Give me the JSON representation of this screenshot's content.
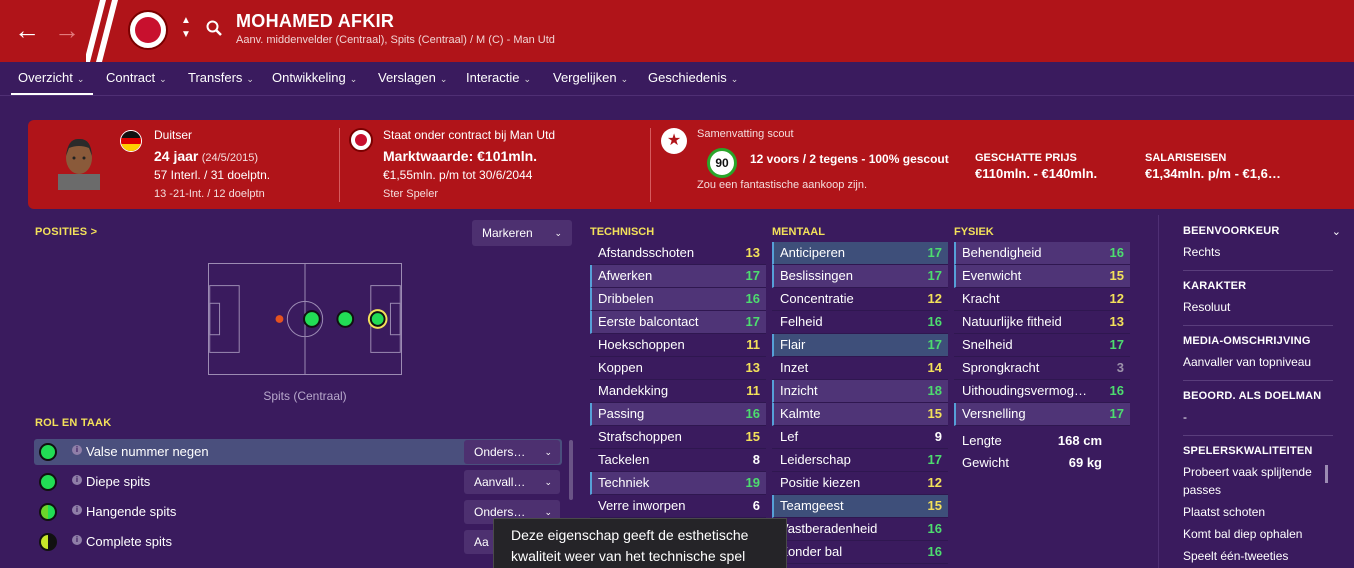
{
  "header": {
    "player_name": "MOHAMED AFKIR",
    "player_subtitle": "Aanv. middenvelder (Centraal), Spits (Centraal) / M (C) - Man Utd",
    "back_icon": "arrow-left-icon",
    "forward_icon": "arrow-right-icon",
    "colors": {
      "header_bg": "#b01419",
      "page_bg": "#3a1b5e"
    }
  },
  "tabs": [
    {
      "label": "Overzicht"
    },
    {
      "label": "Contract"
    },
    {
      "label": "Transfers"
    },
    {
      "label": "Ontwikkeling"
    },
    {
      "label": "Verslagen"
    },
    {
      "label": "Interactie"
    },
    {
      "label": "Vergelijken"
    },
    {
      "label": "Geschiedenis"
    }
  ],
  "summary": {
    "nationality": "Duitser",
    "age": "24 jaar",
    "dob": "(24/5/2015)",
    "caps": "57 Interl. / 31 doelptn.",
    "youth_caps": "13 -21-Int. / 12 doelptn",
    "contract_status": "Staat onder contract bij Man Utd",
    "market_value": "Marktwaarde: €101mln.",
    "wage": "€1,55mln. p/m tot 30/6/2044",
    "status": "Ster Speler",
    "scout_title": "Samenvatting scout",
    "scout_rating": "90",
    "scout_summary": "12 voors / 2 tegens - 100% gescout",
    "scout_note": "Zou een fantastische aankoop zijn.",
    "price_label": "GESCHATTE PRIJS",
    "price_value": "€110mln. - €140mln.",
    "salary_label": "SALARISEISEN",
    "salary_value": "€1,34mln. p/m - €1,6…"
  },
  "positions": {
    "title": "POSITIES",
    "title_suffix": ">",
    "marker_button": "Markeren",
    "pitch_label": "Spits (Centraal)"
  },
  "roles": {
    "title": "ROL EN TAAK",
    "items": [
      {
        "name": "Valse nummer negen",
        "duty": "Onders…",
        "color": "#22dd55"
      },
      {
        "name": "Diepe spits",
        "duty": "Aanvall…",
        "color": "#22dd55"
      },
      {
        "name": "Hangende spits",
        "duty": "Onders…",
        "color": "#6bd62a"
      },
      {
        "name": "Complete spits",
        "duty": "Aa",
        "color": "#c7e62a"
      }
    ]
  },
  "technical": {
    "title": "TECHNISCH",
    "attrs": [
      {
        "name": "Afstandsschoten",
        "value": "13"
      },
      {
        "name": "Afwerken",
        "value": "17"
      },
      {
        "name": "Dribbelen",
        "value": "16"
      },
      {
        "name": "Eerste balcontact",
        "value": "17"
      },
      {
        "name": "Hoekschoppen",
        "value": "11"
      },
      {
        "name": "Koppen",
        "value": "13"
      },
      {
        "name": "Mandekking",
        "value": "11"
      },
      {
        "name": "Passing",
        "value": "16"
      },
      {
        "name": "Strafschoppen",
        "value": "15"
      },
      {
        "name": "Tackelen",
        "value": "8"
      },
      {
        "name": "Techniek",
        "value": "19"
      },
      {
        "name": "Verre inworpen",
        "value": "6"
      }
    ]
  },
  "mental": {
    "title": "MENTAAL",
    "attrs": [
      {
        "name": "Anticiperen",
        "value": "17"
      },
      {
        "name": "Beslissingen",
        "value": "17"
      },
      {
        "name": "Concentratie",
        "value": "12"
      },
      {
        "name": "Felheid",
        "value": "16"
      },
      {
        "name": "Flair",
        "value": "17"
      },
      {
        "name": "Inzet",
        "value": "14"
      },
      {
        "name": "Inzicht",
        "value": "18"
      },
      {
        "name": "Kalmte",
        "value": "15"
      },
      {
        "name": "Lef",
        "value": "9"
      },
      {
        "name": "Leiderschap",
        "value": "17"
      },
      {
        "name": "Positie kiezen",
        "value": "12"
      },
      {
        "name": "Teamgeest",
        "value": "15"
      },
      {
        "name": "Vastberadenheid",
        "value": "16"
      },
      {
        "name": "Zonder bal",
        "value": "16"
      }
    ]
  },
  "physical": {
    "title": "FYSIEK",
    "attrs": [
      {
        "name": "Behendigheid",
        "value": "16"
      },
      {
        "name": "Evenwicht",
        "value": "15"
      },
      {
        "name": "Kracht",
        "value": "12"
      },
      {
        "name": "Natuurlijke fitheid",
        "value": "13"
      },
      {
        "name": "Snelheid",
        "value": "17"
      },
      {
        "name": "Sprongkracht",
        "value": "3"
      },
      {
        "name": "Uithoudingsvermog…",
        "value": "16"
      },
      {
        "name": "Versnelling",
        "value": "17"
      }
    ],
    "height_label": "Lengte",
    "height_value": "168 cm",
    "weight_label": "Gewicht",
    "weight_value": "69 kg"
  },
  "info": {
    "foot_label": "BEENVOORKEUR",
    "foot_value": "Rechts",
    "personality_label": "KARAKTER",
    "personality_value": "Resoluut",
    "media_label": "MEDIA-OMSCHRIJVING",
    "media_value": "Aanvaller van topniveau",
    "gk_label": "BEOORD. ALS DOELMAN",
    "gk_value": "-",
    "traits_label": "SPELERSKWALITEITEN",
    "traits": [
      "Probeert vaak splijtende passes",
      "Plaatst schoten",
      "Komt bal diep ophalen",
      "Speelt één-tweeties"
    ]
  },
  "tooltip": {
    "line1": "Deze eigenschap geeft de esthetische",
    "line2": "kwaliteit weer van het technische spel"
  }
}
